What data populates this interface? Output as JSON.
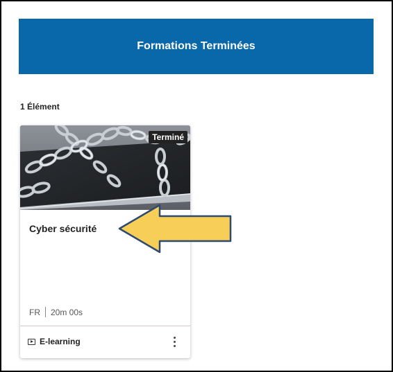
{
  "colors": {
    "banner_bg": "#0868a9",
    "badge_bg": "#222222",
    "arrow_fill": "#f7cf58",
    "arrow_stroke": "#2f4a6e",
    "divider": "#d8c4c4"
  },
  "banner": {
    "title": "Formations Terminées"
  },
  "results": {
    "count_label": "1 Élément"
  },
  "cards": [
    {
      "status_badge": "Terminé",
      "title": "Cyber sécurité",
      "language": "FR",
      "duration": "20m 00s",
      "type_icon": "play-video-icon",
      "type_label": "E-learning",
      "menu_icon": "more-vertical-icon",
      "thumbnail_icon": "chained-laptop-image"
    }
  ],
  "annotation": {
    "icon": "arrow-left-icon"
  }
}
